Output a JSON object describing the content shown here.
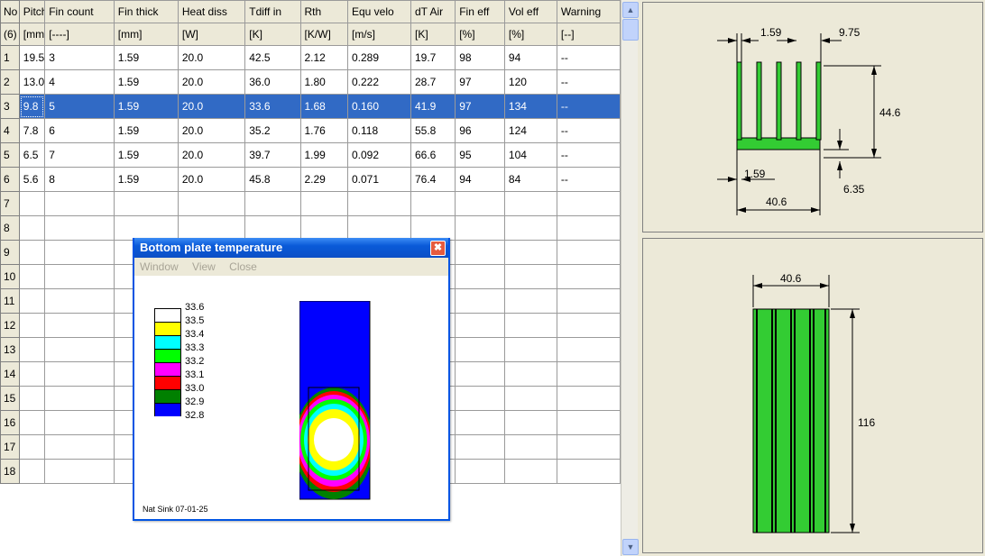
{
  "table": {
    "headers": [
      "No",
      "Pitch",
      "Fin count",
      "Fin thick",
      "Heat diss",
      "Tdiff in",
      "Rth",
      "Equ velo",
      "dT Air",
      "Fin eff",
      "Vol eff",
      "Warning"
    ],
    "units": [
      "(6)",
      "[mm]",
      "[----]",
      "[mm]",
      "[W]",
      "[K]",
      "[K/W]",
      "[m/s]",
      "[K]",
      "[%]",
      "[%]",
      "[--]"
    ],
    "rows": [
      [
        "1",
        "19.5",
        "3",
        "1.59",
        "20.0",
        "42.5",
        "2.12",
        "0.289",
        "19.7",
        "98",
        "94",
        "--"
      ],
      [
        "2",
        "13.0",
        "4",
        "1.59",
        "20.0",
        "36.0",
        "1.80",
        "0.222",
        "28.7",
        "97",
        "120",
        "--"
      ],
      [
        "3",
        "9.8",
        "5",
        "1.59",
        "20.0",
        "33.6",
        "1.68",
        "0.160",
        "41.9",
        "97",
        "134",
        "--"
      ],
      [
        "4",
        "7.8",
        "6",
        "1.59",
        "20.0",
        "35.2",
        "1.76",
        "0.118",
        "55.8",
        "96",
        "124",
        "--"
      ],
      [
        "5",
        "6.5",
        "7",
        "1.59",
        "20.0",
        "39.7",
        "1.99",
        "0.092",
        "66.6",
        "95",
        "104",
        "--"
      ],
      [
        "6",
        "5.6",
        "8",
        "1.59",
        "20.0",
        "45.8",
        "2.29",
        "0.071",
        "76.4",
        "94",
        "84",
        "--"
      ]
    ],
    "empty_rows": [
      "7",
      "8",
      "9",
      "10",
      "11",
      "12",
      "13",
      "14",
      "15",
      "16",
      "17",
      "18"
    ],
    "selected_row": "3"
  },
  "popup": {
    "title": "Bottom plate temperature",
    "menu": [
      "Window",
      "View",
      "Close"
    ],
    "footer": "Nat Sink 07-01-25",
    "legend": [
      {
        "value": "33.6",
        "color": "#ffffff"
      },
      {
        "value": "33.5",
        "color": "#ffff00"
      },
      {
        "value": "33.4",
        "color": "#00ffff"
      },
      {
        "value": "33.3",
        "color": "#00ff00"
      },
      {
        "value": "33.2",
        "color": "#ff00ff"
      },
      {
        "value": "33.1",
        "color": "#ff0000"
      },
      {
        "value": "33.0",
        "color": "#008000"
      },
      {
        "value": "32.9",
        "color": "#0000ff"
      },
      {
        "value": "32.8",
        "color": "#0000ff"
      }
    ]
  },
  "front_view": {
    "fin_thickness": "1.59",
    "gap": "9.75",
    "height": "44.6",
    "base_fin_thickness": "1.59",
    "base_thickness": "6.35",
    "width": "40.6"
  },
  "top_view": {
    "width": "40.6",
    "length": "116"
  },
  "colors": {
    "selection": "#316ac5",
    "heatsink_green": "#33cc33",
    "title_bar": "#0a5ad8"
  }
}
